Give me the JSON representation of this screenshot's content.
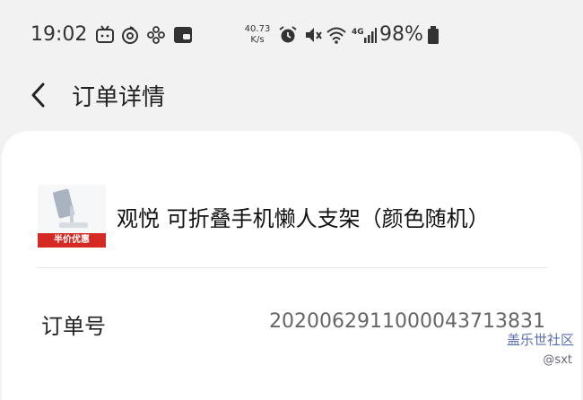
{
  "status_bar": {
    "time": "19:02",
    "net_speed_value": "40.73",
    "net_speed_unit": "K/s",
    "battery": "98%",
    "icons": [
      "tv-icon",
      "moon-icon",
      "pinwheel-icon",
      "wallet-icon",
      "alarm-icon",
      "mute-icon",
      "wifi-icon",
      "signal-4g-icon",
      "battery-icon"
    ]
  },
  "header": {
    "back_icon": "chevron-left-icon",
    "title": "订单详情"
  },
  "product": {
    "badge": "半价优惠",
    "name": "观悦 可折叠手机懒人支架（颜色随机）"
  },
  "order": {
    "label": "订单号",
    "number": "2020062911000043713831"
  },
  "watermark": {
    "brand": "盖乐世社区",
    "user": "@sxt"
  }
}
